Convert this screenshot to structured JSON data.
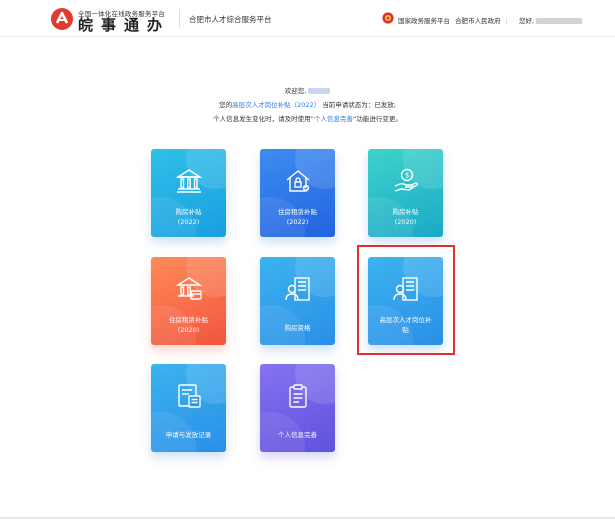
{
  "header": {
    "slogan": "全国一体化在线政务服务平台",
    "brand_name": "皖事通办",
    "platform_name": "合肥市人才综合服务平台",
    "nav": [
      "国家政务服务平台",
      "合肥市人民政府"
    ],
    "greeting": "您好,"
  },
  "welcome": {
    "line1_prefix": "欢迎您,",
    "line2_prefix": "您的",
    "line2_link": "高层次人才岗位补贴（2022）",
    "line2_suffix": "当前申请状态为：已发放;",
    "line3_prefix": "个人信息发生变化时，请及时使用“",
    "line3_link": "个人信息完善",
    "line3_suffix": "”功能进行变更。"
  },
  "tiles": [
    {
      "label_line1": "购房补贴",
      "label_line2": "(2022)",
      "icon": "bank-building-icon"
    },
    {
      "label_line1": "住房租赁补贴",
      "label_line2": "(2022)",
      "icon": "house-lock-icon"
    },
    {
      "label_line1": "购房补贴",
      "label_line2": "(2020)",
      "icon": "hand-coin-icon"
    },
    {
      "label_line1": "住房租赁补贴",
      "label_line2": "(2020)",
      "icon": "bank-card-icon"
    },
    {
      "label_line1": "购房资格",
      "icon": "person-building-icon"
    },
    {
      "label_line1": "高层次人才岗位补",
      "label_line2": "贴",
      "icon": "person-building-icon"
    },
    {
      "label_line1": "申请与发放记录",
      "icon": "form-list-icon"
    },
    {
      "label_line1": "个人信息完善",
      "icon": "clipboard-icon"
    }
  ],
  "colors": {
    "link": "#2c7be5",
    "highlight": "#e0302d"
  }
}
